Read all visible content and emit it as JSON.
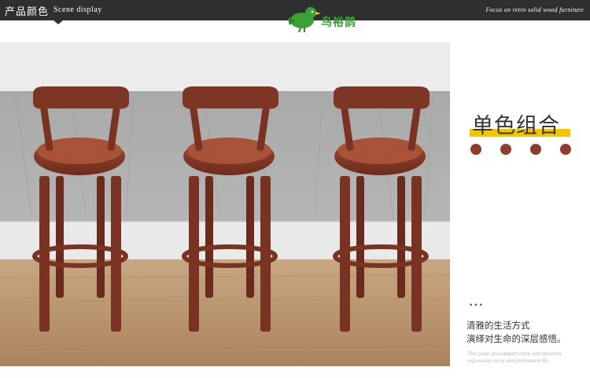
{
  "header": {
    "title": "产品颜色",
    "subtitle": "Scene display",
    "tagline": "Focus on retro solid wood furniture"
  },
  "logo": {
    "brand_text": "鸟裕鹊",
    "icon": "green-bird-icon"
  },
  "photo": {
    "subject": "three-bar-stools",
    "stool_color": "#8b3f2b"
  },
  "panel": {
    "title": "单色组合",
    "swatch_colors": [
      "#8e3d2c",
      "#8e3d2c",
      "#8e3d2c",
      "#8e3d2c"
    ],
    "dots": "•••",
    "description_lines": [
      "清雅的生活方式",
      "演绎对生命的深层感悟。"
    ],
    "english_lines": [
      "The clean and elegant color and structure",
      "expressive force and permanent life."
    ]
  },
  "colors": {
    "topbar": "#2f2f2f",
    "accent_yellow": "#f2c500",
    "brand_green": "#3aa136"
  }
}
